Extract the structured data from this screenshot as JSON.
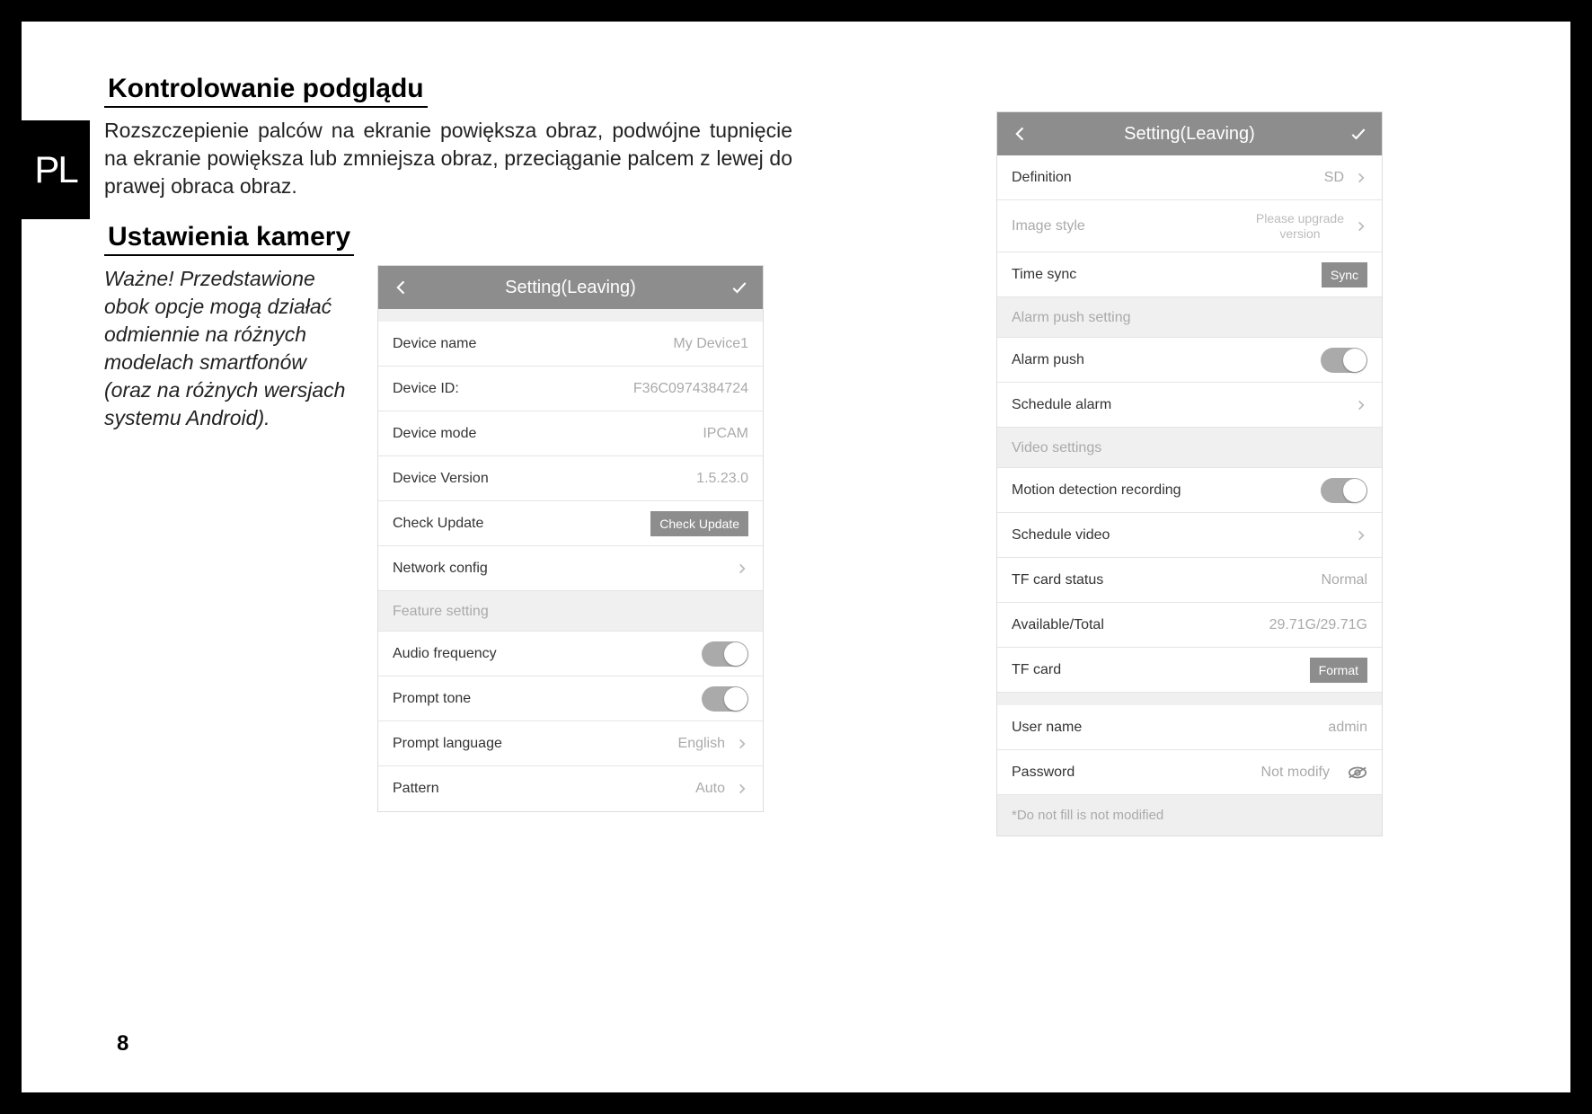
{
  "lang_tab": "PL",
  "page_number": "8",
  "heading1": "Kontrolowanie podglądu",
  "para1": "Rozszczepienie palców na ekranie powiększa obraz, podwójne tupnięcie na ekranie powiększa lub zmniejsza obraz, przeciąganie palcem z lewej do prawej obraca obraz.",
  "heading2": "Ustawienia kamery",
  "note": "Ważne! Przedstawione obok opcje mogą działać odmiennie na różnych modelach smartfonów (oraz na różnych wersjach systemu Android).",
  "panel1": {
    "title": "Setting(Leaving)",
    "device_name_lbl": "Device name",
    "device_name_val": "My Device1",
    "device_id_lbl": "Device ID:",
    "device_id_val": "F36C0974384724",
    "device_mode_lbl": "Device mode",
    "device_mode_val": "IPCAM",
    "device_version_lbl": "Device Version",
    "device_version_val": "1.5.23.0",
    "check_update_lbl": "Check Update",
    "check_update_btn": "Check Update",
    "network_config_lbl": "Network config",
    "feature_setting_hdr": "Feature setting",
    "audio_freq_lbl": "Audio frequency",
    "prompt_tone_lbl": "Prompt tone",
    "prompt_lang_lbl": "Prompt language",
    "prompt_lang_val": "English",
    "pattern_lbl": "Pattern",
    "pattern_val": "Auto"
  },
  "panel2": {
    "title": "Setting(Leaving)",
    "definition_lbl": "Definition",
    "definition_val": "SD",
    "image_style_lbl": "Image style",
    "image_style_val": "Please upgrade version",
    "time_sync_lbl": "Time sync",
    "time_sync_btn": "Sync",
    "alarm_push_hdr": "Alarm push setting",
    "alarm_push_lbl": "Alarm push",
    "schedule_alarm_lbl": "Schedule alarm",
    "video_settings_hdr": "Video settings",
    "motion_detect_lbl": "Motion detection recording",
    "schedule_video_lbl": "Schedule video",
    "tf_status_lbl": "TF card status",
    "tf_status_val": "Normal",
    "avail_total_lbl": "Available/Total",
    "avail_total_val": "29.71G/29.71G",
    "tf_card_lbl": "TF card",
    "tf_card_btn": "Format",
    "username_lbl": "User name",
    "username_val": "admin",
    "password_lbl": "Password",
    "password_val": "Not modify",
    "footer_note": "*Do not fill is not modified"
  }
}
